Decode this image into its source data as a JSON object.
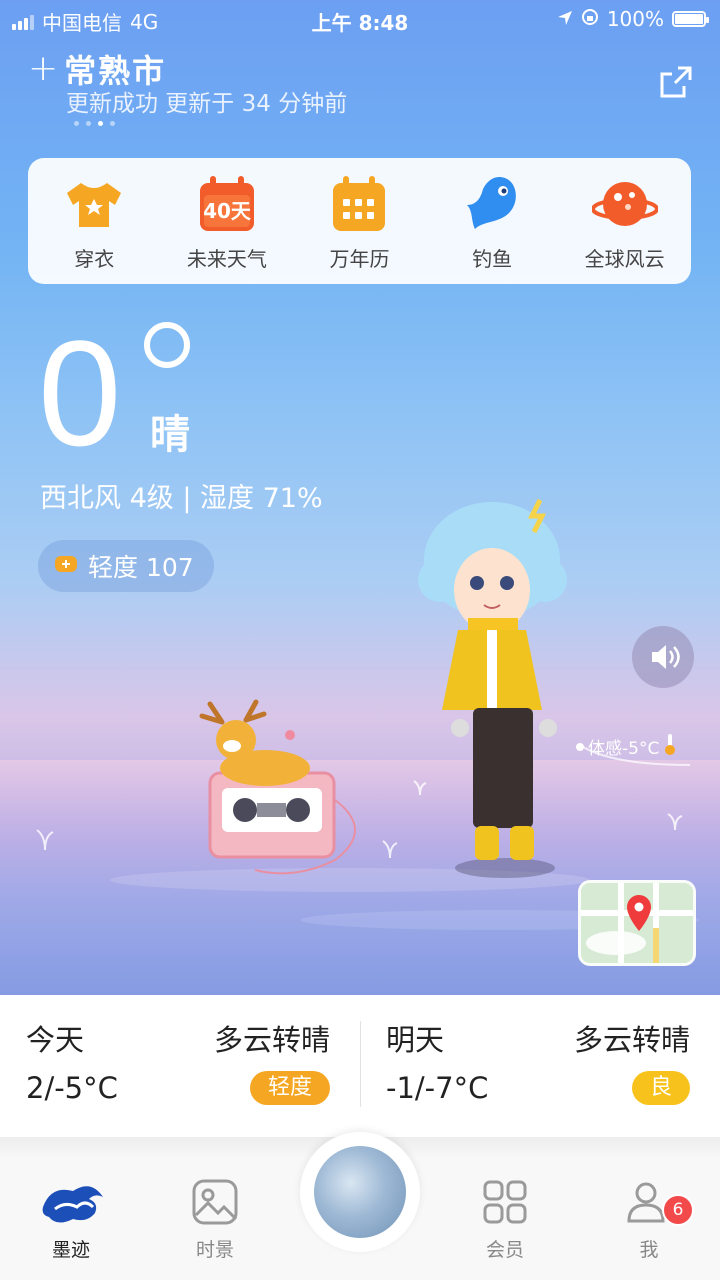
{
  "status_bar": {
    "carrier": "中国电信",
    "network": "4G",
    "time": "上午 8:48",
    "battery": "100%"
  },
  "header": {
    "city": "常熟市",
    "update_status": "更新成功 更新于 34 分钟前",
    "page_dots": 4,
    "active_dot": 2
  },
  "tools": [
    {
      "label": "穿衣",
      "icon": "shirt-icon"
    },
    {
      "label": "未来天气",
      "icon": "calendar-40day-icon",
      "icon_text": "40天"
    },
    {
      "label": "万年历",
      "icon": "calendar-grid-icon"
    },
    {
      "label": "钓鱼",
      "icon": "fish-icon"
    },
    {
      "label": "全球风云",
      "icon": "planet-icon"
    }
  ],
  "current": {
    "temperature": "0",
    "condition": "晴",
    "wind_humidity": "西北风 4级 | 湿度 71%",
    "aqi": "轻度 107",
    "feels_like": "体感-5°C"
  },
  "forecast": [
    {
      "day": "今天",
      "condition": "多云转晴",
      "range": "2/-5°C",
      "aqi": "轻度",
      "aqi_color": "#f5a623"
    },
    {
      "day": "明天",
      "condition": "多云转晴",
      "range": "-1/-7°C",
      "aqi": "良",
      "aqi_color": "#f8c21c"
    }
  ],
  "tabs": [
    {
      "label": "墨迹",
      "icon": "moji-cloud-icon",
      "active": true
    },
    {
      "label": "时景",
      "icon": "photo-icon",
      "active": false
    },
    {
      "label": "会员",
      "icon": "grid-icon",
      "active": false
    },
    {
      "label": "我",
      "icon": "profile-icon",
      "active": false,
      "badge": "6"
    }
  ],
  "colors": {
    "accent": "#f5a623",
    "sky_top": "#6c9ff2",
    "badge_red": "#f24a4a"
  }
}
